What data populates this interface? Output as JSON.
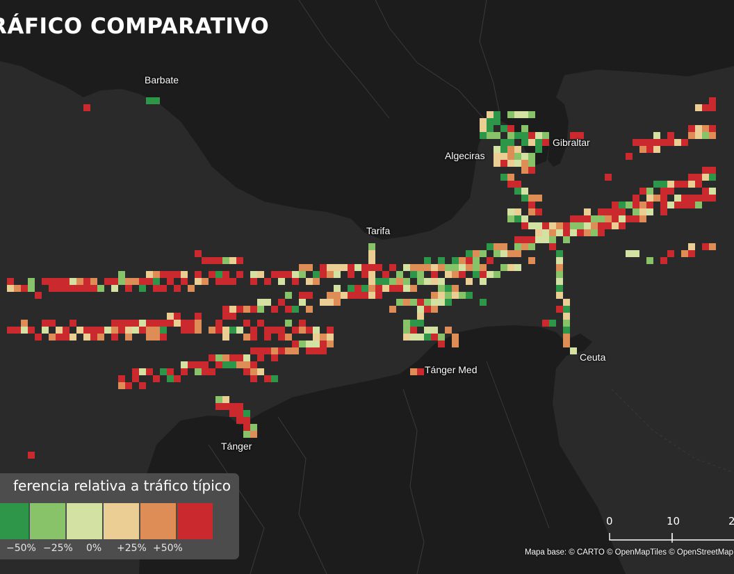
{
  "title": "RÁFICO COMPARATIVO",
  "places": {
    "barbate": "Barbate",
    "algeciras": "Algeciras",
    "gibraltar": "Gibraltar",
    "tarifa": "Tarifa",
    "tanger_med": "Tánger Med",
    "ceuta": "Ceuta",
    "tanger": "Tánger"
  },
  "legend": {
    "title": "ferencia relativa a tráfico típico",
    "colors": [
      "#2e9648",
      "#88c36a",
      "#d3e1a2",
      "#ebce93",
      "#df8d56",
      "#ca2a2d"
    ],
    "labels": [
      "−50%",
      "−25%",
      "0%",
      "+25%",
      "+50%"
    ]
  },
  "scale": {
    "labels": [
      "0",
      "10",
      "2"
    ]
  },
  "attribution": "Mapa base: © CARTO © OpenMapTiles © OpenStreetMap cont"
}
